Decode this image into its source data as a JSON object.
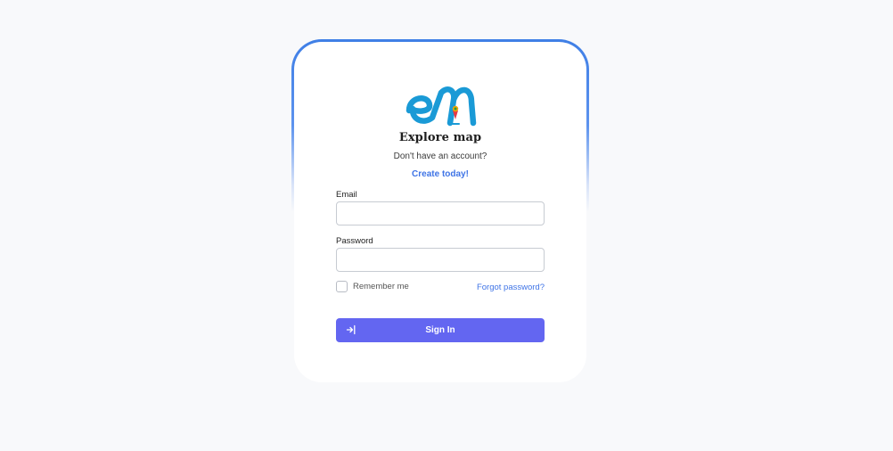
{
  "brand": {
    "logo_icon": "explore-map-logo",
    "name": "Explore map"
  },
  "signup": {
    "question": "Don't have an account?",
    "link": "Create today!"
  },
  "form": {
    "email_label": "Email",
    "email_value": "",
    "password_label": "Password",
    "password_value": "",
    "remember_label": "Remember me",
    "remember_checked": false,
    "forgot_link": "Forgot password?",
    "submit_label": "Sign In",
    "submit_icon": "login-arrow-icon"
  },
  "colors": {
    "accent": "#6366f1",
    "link": "#3f74e6",
    "logo_blue": "#1a9ad6",
    "background": "#f8f9fb"
  }
}
